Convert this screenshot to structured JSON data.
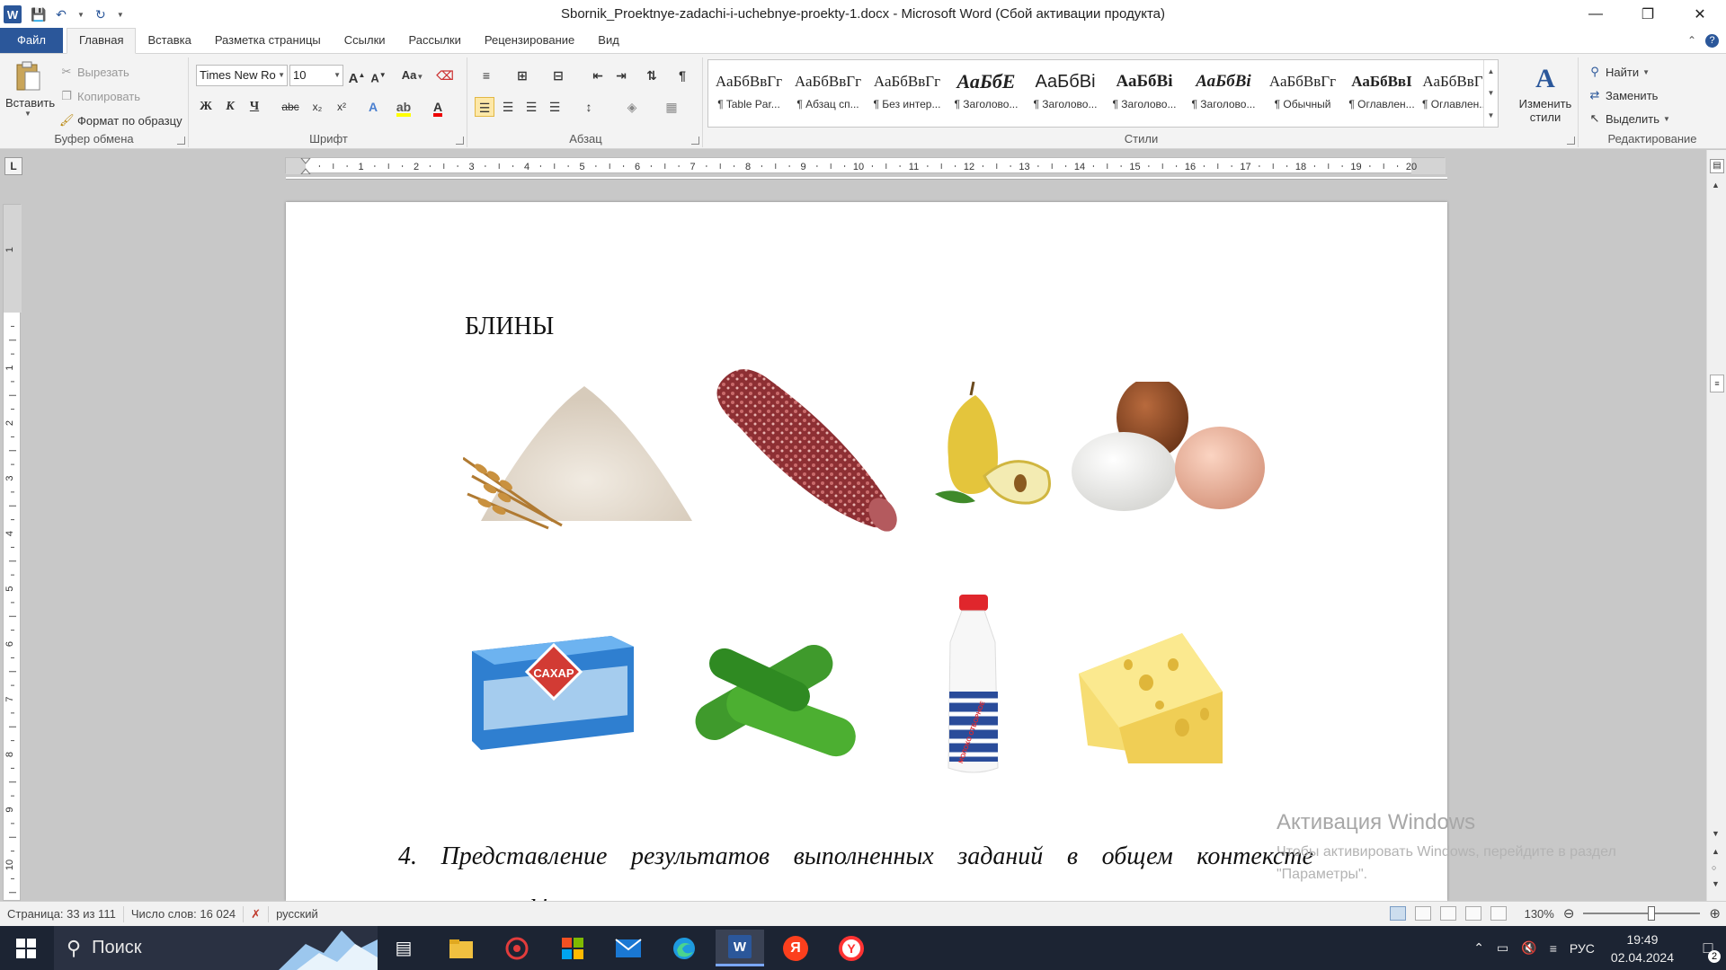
{
  "window": {
    "title": "Sbornik_Proektnye-zadachi-i-uchebnye-proekty-1.docx - Microsoft Word (Сбой активации продукта)",
    "app_icon": "W"
  },
  "tabs": [
    "Файл",
    "Главная",
    "Вставка",
    "Разметка страницы",
    "Ссылки",
    "Рассылки",
    "Рецензирование",
    "Вид"
  ],
  "ribbon": {
    "clipboard": {
      "paste": "Вставить",
      "cut": "Вырезать",
      "copy": "Копировать",
      "format_painter": "Формат по образцу",
      "label": "Буфер обмена"
    },
    "font": {
      "font_name": "Times New Ro",
      "font_size": "10",
      "change_case": "Aa",
      "bold": "Ж",
      "italic": "К",
      "underline": "Ч",
      "strike": "abc",
      "subscript": "x₂",
      "superscript": "x²",
      "label": "Шрифт"
    },
    "paragraph": {
      "label": "Абзац"
    },
    "styles": {
      "label": "Стили",
      "items": [
        {
          "sample": "АаБбВвГг",
          "name": "¶ Table Par..."
        },
        {
          "sample": "АаБбВвГг",
          "name": "¶ Абзац сп..."
        },
        {
          "sample": "АаБбВвГг",
          "name": "¶ Без интер..."
        },
        {
          "sample": "АаБбЕ",
          "name": "¶ Заголово..."
        },
        {
          "sample": "АаБбВі",
          "name": "¶ Заголово..."
        },
        {
          "sample": "АаБбВі",
          "name": "¶ Заголово..."
        },
        {
          "sample": "АаБбВі",
          "name": "¶ Заголово..."
        },
        {
          "sample": "АаБбВвГг",
          "name": "¶ Обычный"
        },
        {
          "sample": "АаБбВвІ",
          "name": "¶ Оглавлен..."
        },
        {
          "sample": "АаБбВвГ",
          "name": "¶ Оглавлен..."
        }
      ],
      "change_styles_line1": "Изменить",
      "change_styles_line2": "стили"
    },
    "editing": {
      "find": "Найти",
      "replace": "Заменить",
      "select": "Выделить",
      "label": "Редактирование"
    }
  },
  "ruler": {
    "h_numbers": [
      "1",
      "2",
      "3",
      "4",
      "5",
      "6",
      "7",
      "8",
      "9",
      "10",
      "11",
      "12",
      "13",
      "14",
      "15",
      "16",
      "17",
      "18",
      "19",
      "20"
    ],
    "v_numbers": [
      "1",
      "1",
      "2",
      "3",
      "4",
      "5",
      "6",
      "7",
      "8",
      "9",
      "10"
    ]
  },
  "document": {
    "heading": "БЛИНЫ",
    "paragraph_words": [
      "4.",
      "Представление",
      "результатов",
      "выполненных",
      "заданий",
      "в",
      "общем",
      "контексте"
    ],
    "paragraph_line2": "ы...",
    "food_images": {
      "sugar_box_label": "САХАР",
      "milk_label": "МОЛОКО ОТБОРНОЕ"
    }
  },
  "watermark": {
    "title": "Активация Windows",
    "line1": "Чтобы активировать Windows, перейдите в раздел",
    "line2": "\"Параметры\"."
  },
  "status": {
    "page": "Страница: 33 из 111",
    "words": "Число слов: 16 024",
    "language": "русский",
    "zoom": "130%"
  },
  "taskbar": {
    "search_placeholder": "Поиск",
    "lang": "РУС",
    "time": "19:49",
    "date": "02.04.2024",
    "notifications": "2"
  },
  "colors": {
    "word_blue": "#2b579a",
    "taskbar": "#1c2433"
  }
}
